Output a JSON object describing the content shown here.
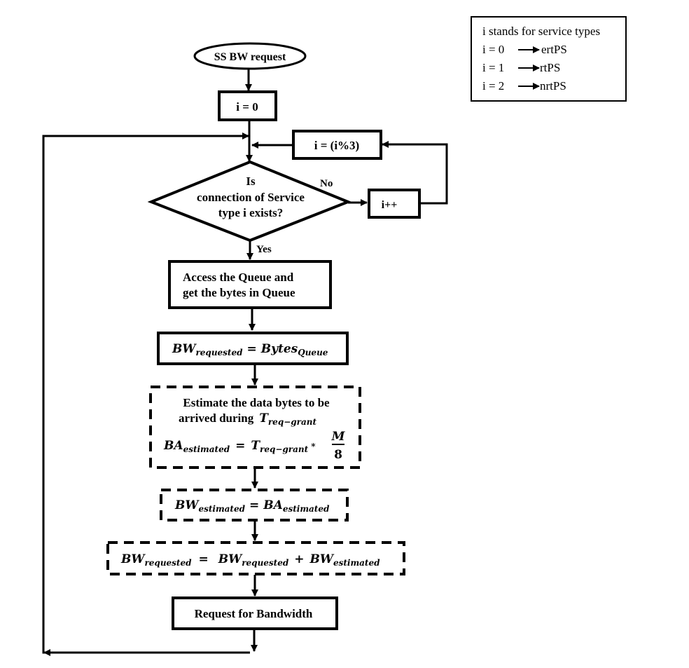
{
  "legend": {
    "title": "i stands for service types",
    "entries": [
      {
        "key": "i = 0",
        "value": "ertPS"
      },
      {
        "key": "i = 1",
        "value": "rtPS"
      },
      {
        "key": "i = 2",
        "value": "nrtPS"
      }
    ]
  },
  "nodes": {
    "start": "SS BW request",
    "init": "i = 0",
    "modulo": "i  = (i%3)",
    "decision": {
      "line1": "Is",
      "line2": "connection of Service",
      "line3": "type i exists?"
    },
    "increment": "i++",
    "access": {
      "line1": "Access the Queue and",
      "line2": "get the bytes in Queue"
    },
    "bw_request_eq": {
      "lhs": "BW",
      "lhs_sub": "requested",
      "eq": "=",
      "rhs": "Bytes",
      "rhs_sub": "Queue"
    },
    "estimate": {
      "line1": "Estimate the data bytes to be",
      "line2": "arrived during",
      "t": "T",
      "t_sub": "req−grant",
      "ba": "BA",
      "ba_sub": "estimated",
      "eq": "=",
      "times": "*",
      "num": "M",
      "den": "8"
    },
    "bw_estimated_eq": {
      "lhs": "BW",
      "lhs_sub": "estimated",
      "eq": "=",
      "rhs": "BA",
      "rhs_sub": "estimated"
    },
    "bw_sum_eq": {
      "lhs": "BW",
      "lhs_sub": "requested",
      "eq": "=",
      "a": "BW",
      "a_sub": "requested",
      "plus": "+",
      "b": "BW",
      "b_sub": "estimated"
    },
    "request": "Request for Bandwidth"
  },
  "edge_labels": {
    "no": "No",
    "yes": "Yes"
  }
}
